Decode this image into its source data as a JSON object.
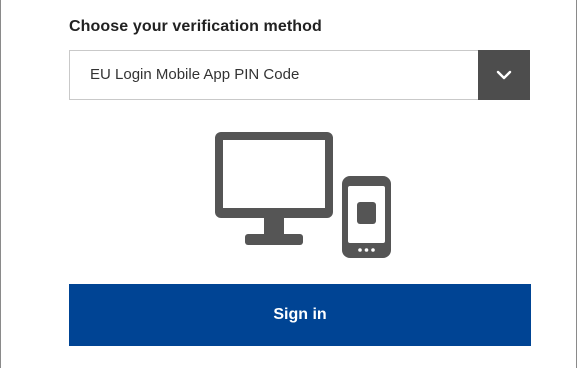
{
  "verification": {
    "label": "Choose your verification method",
    "selected_method": "EU Login Mobile App PIN Code",
    "dropdown_icon": "chevron-down-icon"
  },
  "illustration": {
    "icon": "desktop-and-mobile-icon"
  },
  "actions": {
    "sign_in_label": "Sign in"
  },
  "colors": {
    "primary_button": "#004494",
    "dropdown_arrow_bg": "#4d4d4d",
    "icon_gray": "#555555"
  }
}
